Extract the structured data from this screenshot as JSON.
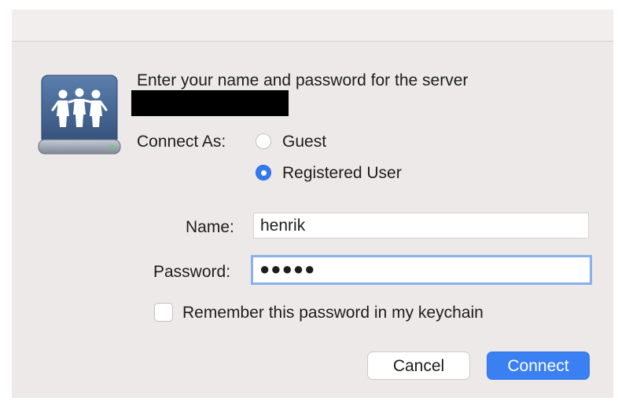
{
  "dialog": {
    "prompt": "Enter your name and password for the server",
    "server_name_redacted": "",
    "connect_as_label": "Connect As:",
    "options": [
      {
        "label": "Guest",
        "selected": false
      },
      {
        "label": "Registered User",
        "selected": true
      }
    ],
    "name_label": "Name:",
    "name_value": "henrik",
    "password_label": "Password:",
    "password_value": "●●●●●",
    "remember_label": "Remember this password in my keychain",
    "remember_checked": false,
    "cancel_label": "Cancel",
    "connect_label": "Connect"
  },
  "colors": {
    "accent": "#3a80f2",
    "focus_ring": "#87b0ec",
    "background": "#ece9e8"
  },
  "icons": {
    "server": "shared-server-drive-icon"
  }
}
